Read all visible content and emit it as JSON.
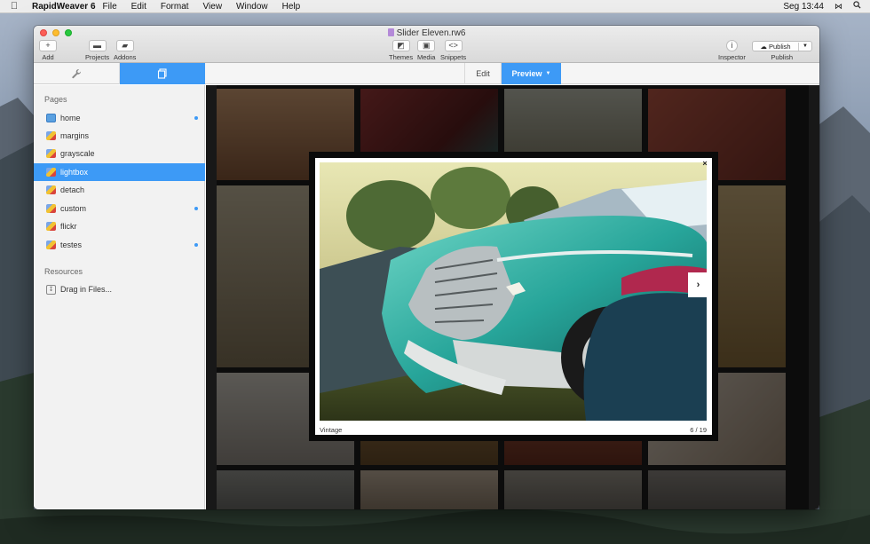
{
  "menubar": {
    "app_name": "RapidWeaver 6",
    "menus": [
      "File",
      "Edit",
      "Format",
      "View",
      "Window",
      "Help"
    ],
    "clock": "Seg 13:44"
  },
  "window": {
    "title": "Slider Eleven.rw6",
    "toolbar": {
      "add": "Add",
      "projects": "Projects",
      "addons": "Addons",
      "themes": "Themes",
      "media": "Media",
      "snippets": "Snippets",
      "inspector": "Inspector",
      "publish_button": "Publish",
      "publish_caption": "Publish"
    },
    "modes": {
      "edit": "Edit",
      "preview": "Preview"
    }
  },
  "sidebar": {
    "pages_header": "Pages",
    "pages": [
      {
        "label": "home",
        "dot": true
      },
      {
        "label": "margins",
        "dot": false
      },
      {
        "label": "grayscale",
        "dot": false
      },
      {
        "label": "lightbox",
        "dot": false,
        "selected": true
      },
      {
        "label": "detach",
        "dot": false
      },
      {
        "label": "custom",
        "dot": true
      },
      {
        "label": "flickr",
        "dot": false
      },
      {
        "label": "testes",
        "dot": true
      }
    ],
    "resources_header": "Resources",
    "resources_item": "Drag in Files..."
  },
  "lightbox": {
    "caption": "Vintage",
    "counter": "6 / 19",
    "close_glyph": "×",
    "next_glyph": "›"
  },
  "colors": {
    "accent": "#3d9af6",
    "lightbox_frame": "#0a0a0a"
  },
  "icons": {
    "wrench": "wrench-icon",
    "pages": "pages-icon",
    "chevron_down": "chevron-down-icon"
  }
}
